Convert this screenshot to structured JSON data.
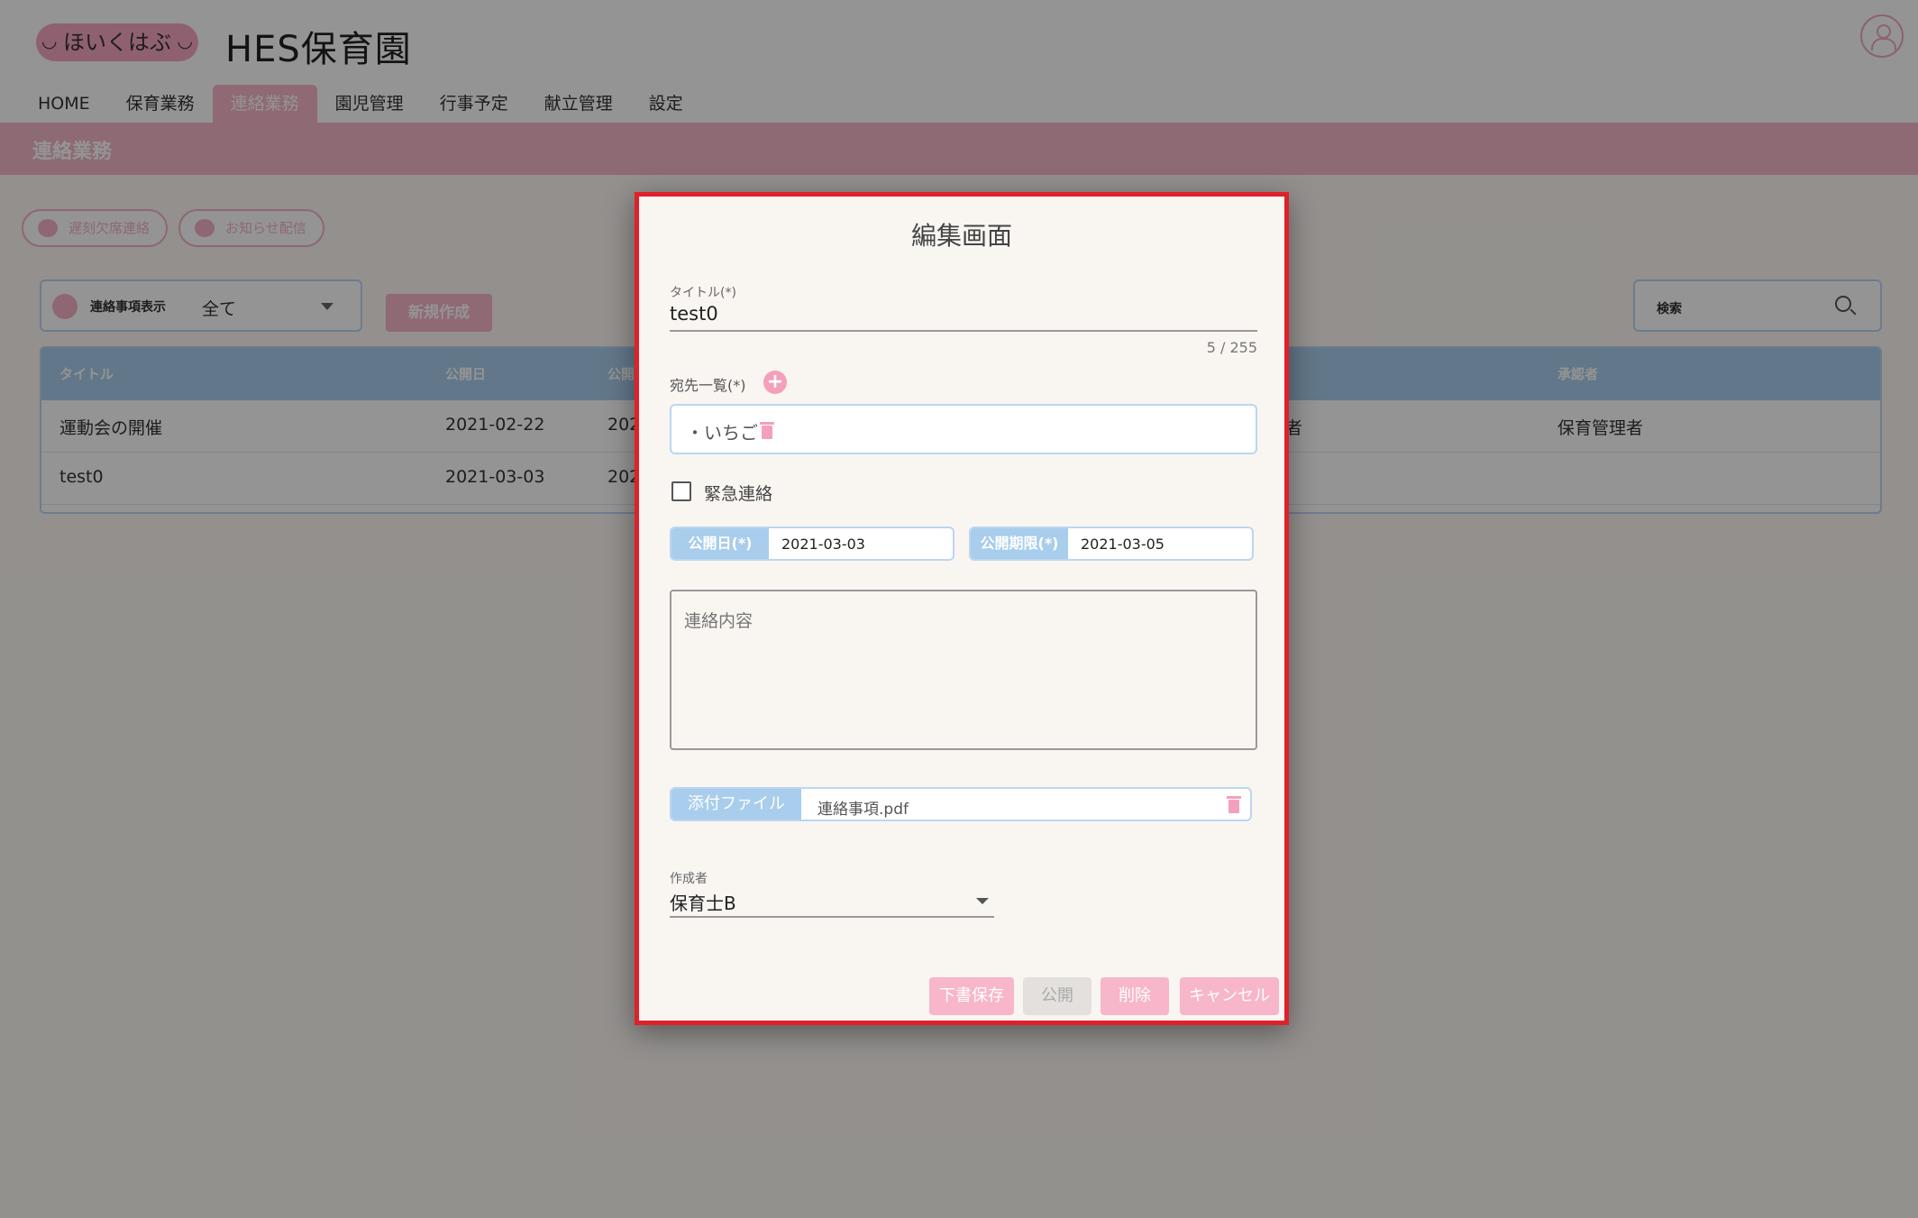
{
  "header": {
    "logo_text": "ほいくはぶ",
    "site_title": "HES保育園"
  },
  "nav": [
    "HOME",
    "保育業務",
    "連絡業務",
    "園児管理",
    "行事予定",
    "献立管理",
    "設定"
  ],
  "banner": {
    "title": "連絡業務"
  },
  "pills": {
    "absence": "遅刻欠席連絡",
    "notice": "お知らせ配信"
  },
  "filter": {
    "label": "連絡事項表示",
    "value": "全て"
  },
  "new_button": "新規作成",
  "search": {
    "placeholder": "検索"
  },
  "table": {
    "headers": [
      "タイトル",
      "公開日",
      "公開",
      "承認者"
    ],
    "rows": [
      {
        "title": "運動会の開催",
        "date": "2021-02-22",
        "col3": "202",
        "status": "者",
        "approver": "保育管理者"
      },
      {
        "title": "test0",
        "date": "2021-03-03",
        "col3": "202",
        "status": "",
        "approver": ""
      }
    ]
  },
  "modal": {
    "heading": "編集画面",
    "title_label": "タイトル(*)",
    "title_value": "test0",
    "counter": "5 / 255",
    "destination_label": "宛先一覧(*)",
    "destinations": [
      "・いちご"
    ],
    "urgent_label": "緊急連絡",
    "publish_date_label": "公開日(*)",
    "publish_date": "2021-03-03",
    "deadline_label": "公開期限(*)",
    "deadline": "2021-03-05",
    "content_placeholder": "連絡内容",
    "attachment_label": "添付ファイル",
    "attachment_name": "連絡事項.pdf",
    "author_label": "作成者",
    "author_value": "保育士B",
    "buttons": {
      "draft": "下書保存",
      "publish": "公開",
      "delete": "削除",
      "cancel": "キャンセル"
    }
  },
  "colors": {
    "accent_pink": "#f7b6c9",
    "accent_blue": "#a9cdec",
    "highlight_red": "#e0202a"
  }
}
